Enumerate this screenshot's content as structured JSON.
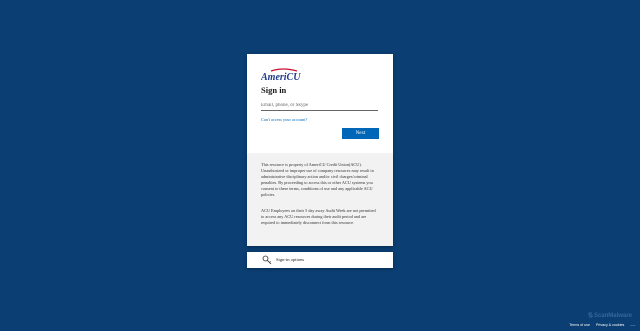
{
  "signin_card": {
    "logo_text": "AmeriCU",
    "title": "Sign in",
    "input_placeholder": "Email, phone, or Skype",
    "cant_access_link": "Can't access your account?",
    "next_button": "Next",
    "notice_paragraph_1": "This resource is property of AmeriCU Credit Union(ACU). Unauthorized or improper use of company resources may result in administrative disciplinary action and/or civil charges/criminal penalties. By proceeding to access this or other ACU systems you consent to these terms, conditions of use and any applicable ACU policies.",
    "notice_paragraph_2": "ACU Employees on their 5 day away Audit Week are not permitted to access any ACU resources during their audit period and are required to immediately disconnect from this resource."
  },
  "signin_options": {
    "label": "Sign-in options",
    "icon": "key-icon"
  },
  "watermark": {
    "text": "ScanMalware"
  },
  "footer": {
    "terms": "Terms of use",
    "privacy": "Privacy & cookies",
    "more": "..."
  },
  "colors": {
    "background": "#0b3e72",
    "accent": "#0067b8",
    "logo_red": "#c8102e",
    "logo_blue": "#1f3c88"
  }
}
